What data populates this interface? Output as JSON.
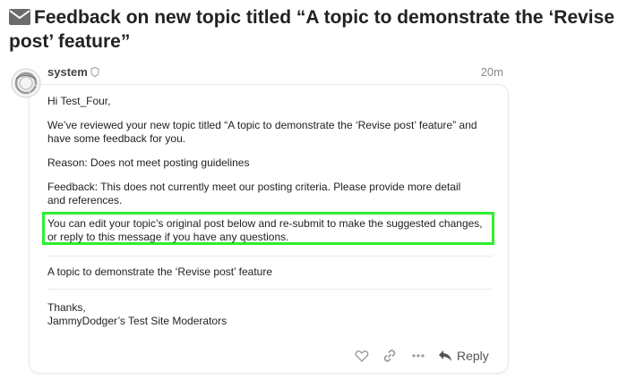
{
  "topic": {
    "title": "Feedback on new topic titled “A topic to demonstrate the ‘Revise post’ feature”"
  },
  "post": {
    "username": "system",
    "timestamp": "20m",
    "greeting": "Hi Test_Four,",
    "review": "We’ve reviewed your new topic titled “A topic to demonstrate the ‘Revise post’ feature” and have some feedback for you.",
    "reason": "Reason: Does not meet posting guidelines",
    "feedback": "Feedback: This does not currently meet our posting criteria. Please provide more detail and references.",
    "edit_notice": "You can edit your topic’s original post below and re-submit to make the suggested changes, or reply to this message if you have any questions.",
    "topic_reference": "A topic to demonstrate the ‘Revise post’ feature",
    "signoff": "Thanks,",
    "signature": "JammyDodger’s Test Site Moderators"
  },
  "actions": {
    "reply_label": "Reply"
  },
  "colors": {
    "highlight": "#2ef02e",
    "text": "#222222",
    "muted": "#888888"
  },
  "icons": [
    "envelope-icon",
    "shield-icon",
    "heart-icon",
    "link-icon",
    "more-icon",
    "reply-icon"
  ]
}
